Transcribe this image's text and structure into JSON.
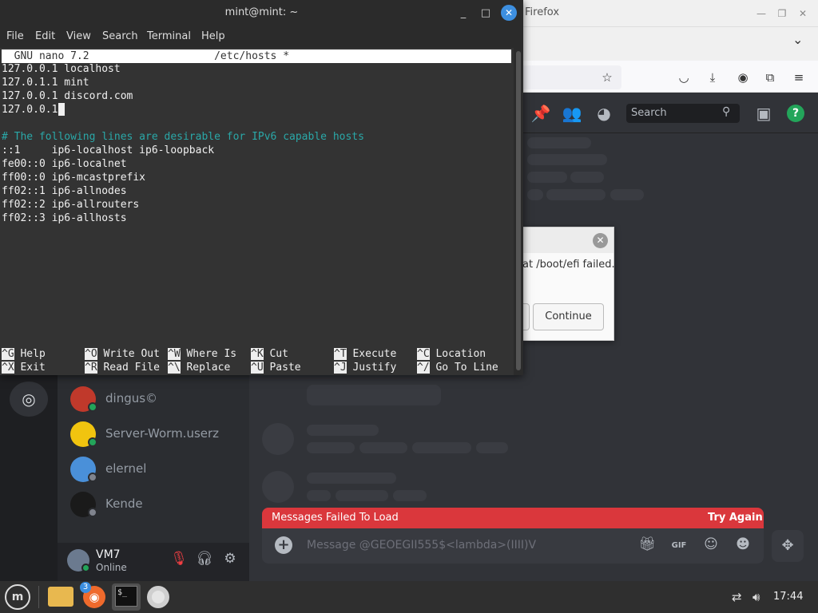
{
  "firefox": {
    "title": "Firefox"
  },
  "discord": {
    "search_placeholder": "Search",
    "members": [
      {
        "name": "dingus©",
        "status_color": "#23a55a",
        "avatar_color": "#c0392b"
      },
      {
        "name": "Server-Worm.userz",
        "status_color": "#23a55a",
        "avatar_color": "#f1c40f"
      },
      {
        "name": "elernel",
        "status_color": "#80848e",
        "avatar_color": "#4a90d9"
      },
      {
        "name": "Kende",
        "status_color": "#80848e",
        "avatar_color": "#1a1a1a"
      }
    ],
    "user": {
      "name": "VM7",
      "status": "Online"
    },
    "error_banner": {
      "message": "Messages Failed To Load",
      "action": "Try Again"
    },
    "message_placeholder": "Message @GEOEGII555$<lambda>(IIII)V"
  },
  "dialog": {
    "message": "at /boot/efi failed.",
    "continue_label": "Continue"
  },
  "terminal": {
    "title": "mint@mint: ~",
    "menu": [
      "File",
      "Edit",
      "View",
      "Search",
      "Terminal",
      "Help"
    ],
    "nano_header": "  GNU nano 7.2                    /etc/hosts *",
    "lines": [
      {
        "text": "127.0.0.1 localhost",
        "type": "text"
      },
      {
        "text": "127.0.1.1 mint",
        "type": "text"
      },
      {
        "text": "127.0.0.1 discord.com",
        "type": "text"
      },
      {
        "text": "127.0.0.1",
        "type": "text"
      },
      {
        "text": "",
        "type": "text"
      },
      {
        "text": "# The following lines are desirable for IPv6 capable hosts",
        "type": "comment"
      },
      {
        "text": "::1     ip6-localhost ip6-loopback",
        "type": "text"
      },
      {
        "text": "fe00::0 ip6-localnet",
        "type": "text"
      },
      {
        "text": "ff00::0 ip6-mcastprefix",
        "type": "text"
      },
      {
        "text": "ff02::1 ip6-allnodes",
        "type": "text"
      },
      {
        "text": "ff02::2 ip6-allrouters",
        "type": "text"
      },
      {
        "text": "ff02::3 ip6-allhosts",
        "type": "text"
      }
    ],
    "shortcuts_row1": [
      {
        "key": "^G",
        "label": "Help"
      },
      {
        "key": "^O",
        "label": "Write Out"
      },
      {
        "key": "^W",
        "label": "Where Is"
      },
      {
        "key": "^K",
        "label": "Cut"
      },
      {
        "key": "^T",
        "label": "Execute"
      },
      {
        "key": "^C",
        "label": "Location"
      }
    ],
    "shortcuts_row2": [
      {
        "key": "^X",
        "label": "Exit"
      },
      {
        "key": "^R",
        "label": "Read File"
      },
      {
        "key": "^\\",
        "label": "Replace"
      },
      {
        "key": "^U",
        "label": "Paste"
      },
      {
        "key": "^J",
        "label": "Justify"
      },
      {
        "key": "^/",
        "label": "Go To Line"
      }
    ]
  },
  "taskbar": {
    "menu_label": "m",
    "firefox_badge": "3",
    "terminal_icon_text": "$_",
    "clock": "17:44"
  }
}
